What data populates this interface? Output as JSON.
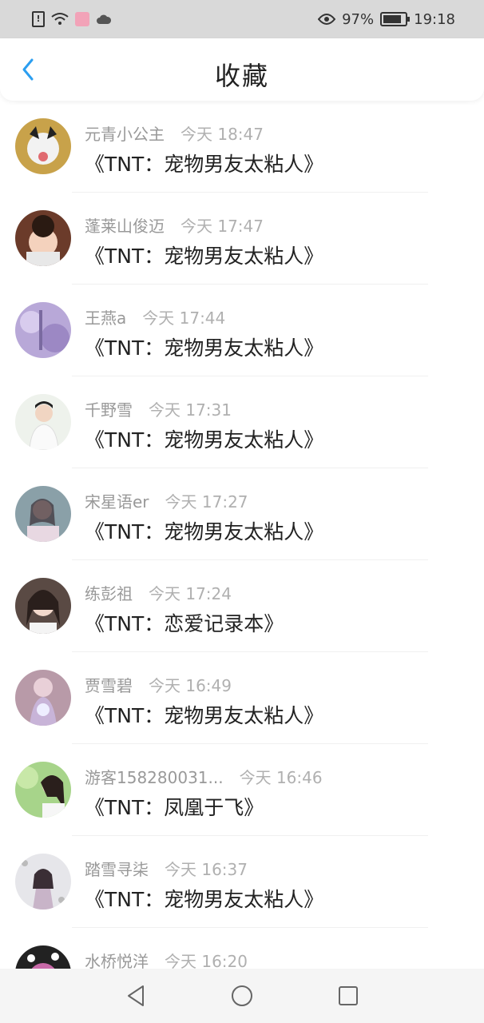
{
  "status_bar": {
    "battery_percent": "97%",
    "time": "19:18",
    "icons": [
      "sim-alert-icon",
      "wifi-icon",
      "app-notification-icon",
      "cloud-icon",
      "eye-icon",
      "battery-icon"
    ]
  },
  "header": {
    "title": "收藏",
    "back_icon": "chevron-left-icon"
  },
  "colors": {
    "accent": "#2b9ef0",
    "status_bar_bg": "#d9d9d9",
    "name_text": "#999999",
    "title_text": "#222222"
  },
  "items": [
    {
      "user": "元青小公主",
      "time": "今天 18:47",
      "title": "《TNT：宠物男友太粘人》"
    },
    {
      "user": "蓬莱山俊迈",
      "time": "今天 17:47",
      "title": "《TNT：宠物男友太粘人》"
    },
    {
      "user": "王燕a",
      "time": "今天 17:44",
      "title": "《TNT：宠物男友太粘人》"
    },
    {
      "user": "千野雪",
      "time": "今天 17:31",
      "title": "《TNT：宠物男友太粘人》"
    },
    {
      "user": "宋星语er",
      "time": "今天 17:27",
      "title": "《TNT：宠物男友太粘人》"
    },
    {
      "user": "练彭祖",
      "time": "今天 17:24",
      "title": "《TNT：恋爱记录本》"
    },
    {
      "user": "贾雪碧",
      "time": "今天 16:49",
      "title": "《TNT：宠物男友太粘人》"
    },
    {
      "user": "游客158280031...",
      "time": "今天 16:46",
      "title": "《TNT：凤凰于飞》"
    },
    {
      "user": "踏雪寻柒",
      "time": "今天 16:37",
      "title": "《TNT：宠物男友太粘人》"
    },
    {
      "user": "水桥悦洋",
      "time": "今天 16:20",
      "title": ""
    }
  ],
  "nav": {
    "back_icon": "triangle-back-icon",
    "home_icon": "circle-home-icon",
    "recents_icon": "square-recents-icon"
  }
}
